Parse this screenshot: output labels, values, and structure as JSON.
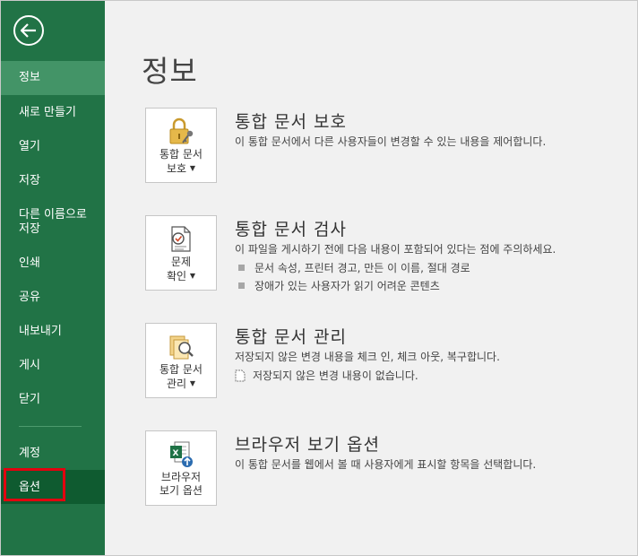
{
  "sidebar": {
    "items": [
      {
        "label": "정보"
      },
      {
        "label": "새로 만들기"
      },
      {
        "label": "열기"
      },
      {
        "label": "저장"
      },
      {
        "label_line1": "다른 이름으로",
        "label_line2": "저장"
      },
      {
        "label": "인쇄"
      },
      {
        "label": "공유"
      },
      {
        "label": "내보내기"
      },
      {
        "label": "게시"
      },
      {
        "label": "닫기"
      },
      {
        "label": "계정"
      },
      {
        "label": "옵션"
      }
    ]
  },
  "main": {
    "title": "정보",
    "sections": [
      {
        "tile_line1": "통합 문서",
        "tile_line2": "보호",
        "icon": "lock-key-icon",
        "title": "통합 문서 보호",
        "desc": "이 통합 문서에서 다른 사용자들이 변경할 수 있는 내용을 제어합니다."
      },
      {
        "tile_line1": "문제",
        "tile_line2": "확인",
        "icon": "inspect-document-icon",
        "title": "통합 문서 검사",
        "desc": "이 파일을 게시하기 전에 다음 내용이 포함되어 있다는 점에 주의하세요.",
        "bullets": [
          "문서 속성, 프린터 경고, 만든 이 이름, 절대 경로",
          "장애가 있는 사용자가 읽기 어려운 콘텐츠"
        ]
      },
      {
        "tile_line1": "통합 문서",
        "tile_line2": "관리",
        "icon": "manage-workbook-icon",
        "title": "통합 문서 관리",
        "desc": "저장되지 않은 변경 내용을 체크 인, 체크 아웃, 복구합니다.",
        "note": "저장되지 않은 변경 내용이 없습니다."
      },
      {
        "tile_line1": "브라우저",
        "tile_line2": "보기 옵션",
        "icon": "excel-browser-icon",
        "title": "브라우저 보기 옵션",
        "desc": "이 통합 문서를 웹에서 볼 때 사용자에게 표시할 항목을 선택합니다."
      }
    ]
  },
  "colors": {
    "sidebar_bg": "#217346",
    "sidebar_active": "#439467",
    "options_bg": "#0f5b30",
    "highlight": "#e3000f"
  }
}
